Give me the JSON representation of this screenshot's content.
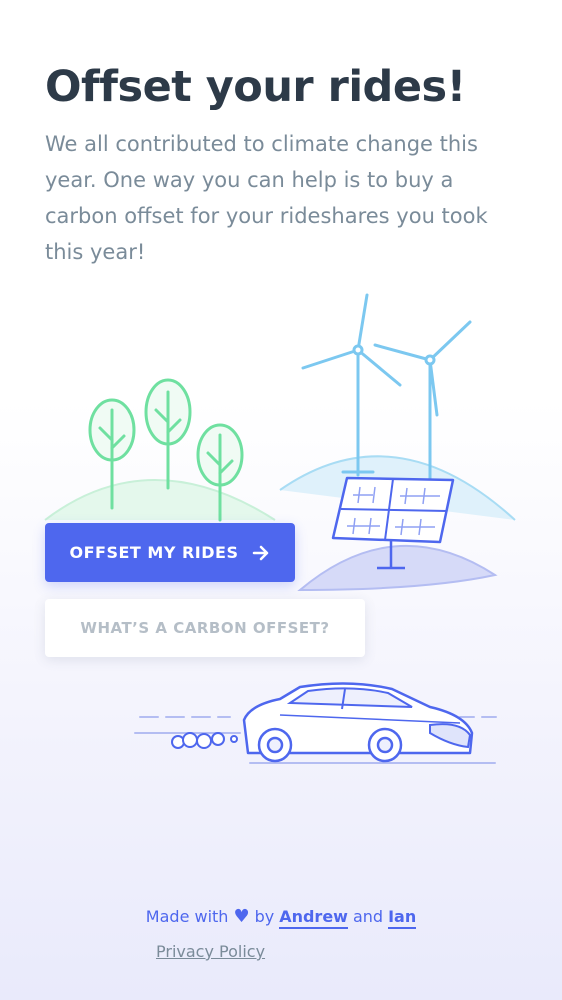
{
  "header": {
    "title": "Offset your rides!",
    "intro": "We all contributed to climate change this year. One way you can help is to buy a carbon offset for your rideshares you took this year!"
  },
  "actions": {
    "primary_label": "OFFSET MY RIDES",
    "primary_icon": "arrow-right-icon",
    "secondary_label": "WHAT’S A CARBON OFFSET?"
  },
  "footer": {
    "made_with": "Made with",
    "by": "by",
    "author1": "Andrew",
    "and": "and",
    "author2": "Ian",
    "privacy": "Privacy Policy"
  },
  "colors": {
    "accent": "#4e67ee",
    "title": "#2d3a48",
    "body": "#7a8b99",
    "trees": "#6fe0a0",
    "turbines": "#7cc8f0"
  }
}
